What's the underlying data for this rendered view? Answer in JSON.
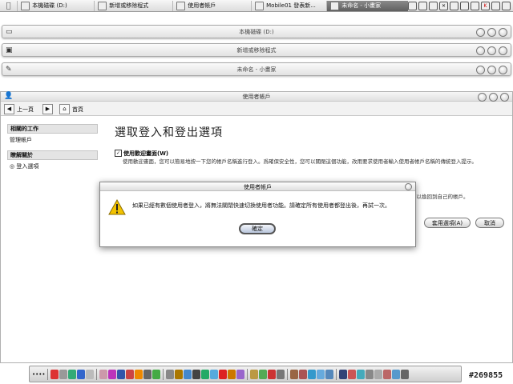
{
  "menubar": {
    "tabs": [
      {
        "label": "本機磁碟 (D:)",
        "active": false
      },
      {
        "label": "新增或移除程式",
        "active": false
      },
      {
        "label": "使用者帳戶",
        "active": false
      },
      {
        "label": "Mobile01 發表新...",
        "active": false
      },
      {
        "label": "未命名 - 小畫家",
        "active": true
      }
    ]
  },
  "collapsed_windows": [
    {
      "title": "本機磁碟 (D:)",
      "icon": "drive-icon"
    },
    {
      "title": "新增或移除程式",
      "icon": "add-remove-icon"
    },
    {
      "title": "未命名 - 小畫家",
      "icon": "paint-icon"
    }
  ],
  "main_window": {
    "title": "使用者帳戶",
    "back_label": "上一頁",
    "home_label": "首頁"
  },
  "sidebar": {
    "related_header": "相關的工作",
    "related_items": [
      "管理帳戶"
    ],
    "learn_header": "瞭解關於",
    "learn_items": [
      "登入選項"
    ]
  },
  "content": {
    "heading": "選取登入和登出選項",
    "option_label": "使用歡迎畫面(W)",
    "option_desc": "使用歡迎畫面，您可以簡易地按一下您的帳戶名稱進行登入。爲確保安全性，您可以關閉這個功能，改用要求使用者輸入使用者帳戶名稱的傳統登入提示。",
    "partial_text": "可以換回到自己的帳戶。",
    "apply_label": "套用選項(A)",
    "cancel_label": "取消"
  },
  "dialog": {
    "title": "使用者帳戶",
    "message": "如果已經有數個使用者登入，將無法關閉快速切換使用者功能。請確定所有使用者都登出後，再試一次。",
    "ok_label": "確定"
  },
  "watermark": "#269855",
  "colors": {
    "warning": "#f2c200",
    "active_tab": "#6b6b6b"
  }
}
